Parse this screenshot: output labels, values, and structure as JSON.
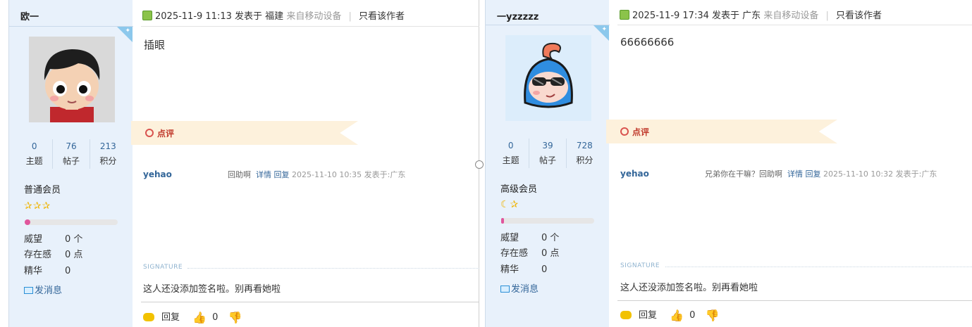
{
  "posts": [
    {
      "author": {
        "name": "欧一",
        "stats": [
          {
            "value": "0",
            "label": "主题"
          },
          {
            "value": "76",
            "label": "帖子"
          },
          {
            "value": "213",
            "label": "积分"
          }
        ],
        "group": "普通会员",
        "stars": "✰✰✰",
        "level_progress": 0.06,
        "prestige_label": "威望",
        "prestige_value": "0 个",
        "presence_label": "存在感",
        "presence_value": "0 点",
        "essence_label": "精华",
        "essence_value": "0",
        "message_label": "发消息"
      },
      "header": {
        "datetime": "2025-11-9 11:13",
        "posted_in": "发表于",
        "location": "福建",
        "device": "来自移动设备",
        "only_author": "只看该作者"
      },
      "content": "插眼",
      "comment_section_label": "点评",
      "comment": {
        "user": "yehao",
        "text": "回助啊",
        "detail": "详情",
        "reply": "回复",
        "time": "2025-11-10 10:35 发表于:广东"
      },
      "signature_label": "SIGNATURE",
      "signature": "这人还没添加签名啦。别再看她啦",
      "footer": {
        "reply": "回复",
        "likes": "0"
      }
    },
    {
      "author": {
        "name": "一yzzzzz",
        "stats": [
          {
            "value": "0",
            "label": "主题"
          },
          {
            "value": "39",
            "label": "帖子"
          },
          {
            "value": "728",
            "label": "积分"
          }
        ],
        "group": "高级会员",
        "stars": "☾✰",
        "level_progress": 0.03,
        "prestige_label": "威望",
        "prestige_value": "0 个",
        "presence_label": "存在感",
        "presence_value": "0 点",
        "essence_label": "精华",
        "essence_value": "0",
        "message_label": "发消息"
      },
      "header": {
        "datetime": "2025-11-9 17:34",
        "posted_in": "发表于",
        "location": "广东",
        "device": "来自移动设备",
        "only_author": "只看该作者"
      },
      "content": "66666666",
      "comment_section_label": "点评",
      "comment": {
        "user": "yehao",
        "text": "兄弟你在干嘛？回助啊",
        "detail": "详情",
        "reply": "回复",
        "time": "2025-11-10 10:32 发表于:广东"
      },
      "signature_label": "SIGNATURE",
      "signature": "这人还没添加签名啦。别再看她啦",
      "footer": {
        "reply": "回复",
        "likes": "0"
      }
    }
  ],
  "colors": {
    "sidebar_bg": "#e8f1fb",
    "link": "#336699",
    "ribbon": "#fdf1dc",
    "accent_red": "#c0392b"
  }
}
